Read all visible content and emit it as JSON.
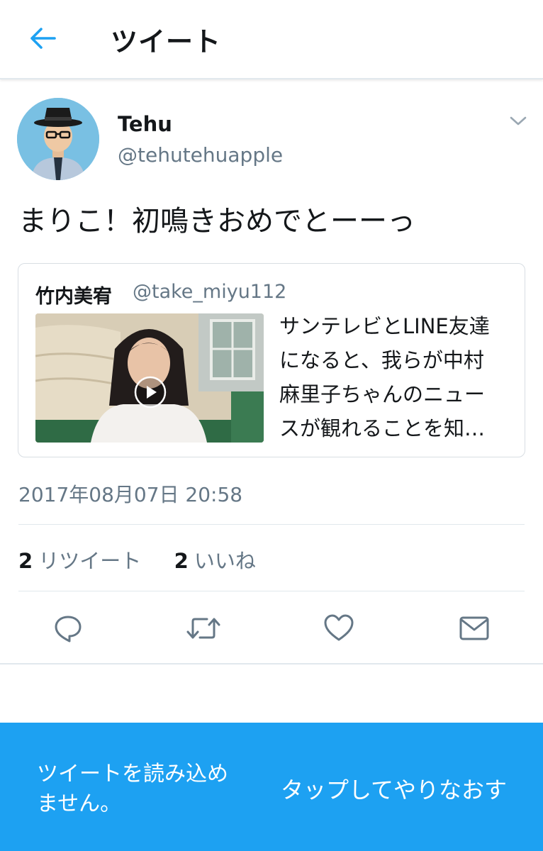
{
  "header": {
    "title": "ツイート",
    "back_icon": "arrow-left-icon",
    "accent_color": "#1da1f2"
  },
  "tweet": {
    "author": {
      "name": "Tehu",
      "handle": "@tehutehuapple"
    },
    "text": "まりこ！初鳴きおめでとーーっ",
    "quoted": {
      "author_name": "竹内美宥",
      "author_handle": "@take_miyu112",
      "text_lines": [
        "サンテレビとLINE友達",
        "になると、我らが中村",
        "麻里子ちゃんのニュー",
        "スが観れることを知…"
      ],
      "media_type": "video"
    },
    "timestamp": "2017年08月07日 20:58",
    "stats": {
      "retweet_count": "2",
      "retweet_label": "リツイート",
      "like_count": "2",
      "like_label": "いいね"
    }
  },
  "actions": [
    "reply-icon",
    "retweet-icon",
    "like-icon",
    "direct-message-icon"
  ],
  "error_bar": {
    "message_lines": [
      "ツイートを読み込め",
      "ません。"
    ],
    "retry_label": "タップしてやりなおす",
    "background_color": "#1da1f2"
  }
}
